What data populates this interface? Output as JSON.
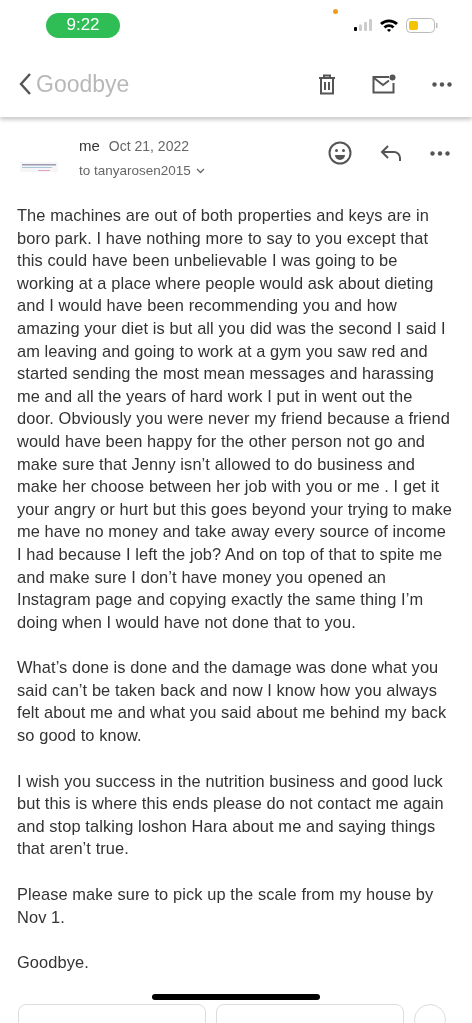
{
  "status_bar": {
    "time": "9:22"
  },
  "header": {
    "title": "Goodbye"
  },
  "message": {
    "sender": "me",
    "date": "Oct 21, 2022",
    "recipient": "to tanyarosen2015",
    "paragraphs": [
      "The machines are out of both properties and keys are in boro park. I have nothing more to say to you except that this could have been unbelievable I was going to be working at a place where people would ask about dieting and I would have been recommending you and how amazing your diet is but all you did was the second I said I am leaving and going to work at a gym you saw red and started sending the most mean messages and harassing me and all the years of hard work I put in went out the door. Obviously you were never my friend because a friend would have been happy for the other person not go and make sure that Jenny isn’t allowed to do business and make her choose between her job with you or me . I get it your angry or hurt but this goes beyond your trying to make me have no money and take away every source of income I had because I left the job? And on top of that to spite me and make sure I don’t have money you opened an Instagram page and copying exactly the same thing I’m doing when I would have not done that to you.",
      "What’s done is done and the damage was done what you said can’t be taken back and now I know how you always felt about me and what you said about me behind my back so good to know.",
      "I wish you success in the nutrition business and good luck but this is where this ends please do not contact me again and stop talking loshon Hara about me and saying things that aren’t true.",
      "Please make sure to pick up the scale from my house by Nov 1.",
      "Goodbye."
    ]
  }
}
